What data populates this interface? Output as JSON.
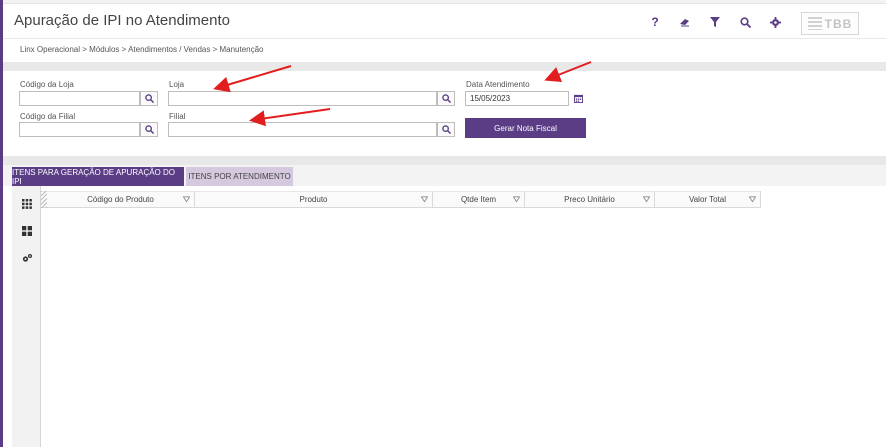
{
  "header": {
    "title": "Apuração de IPI no Atendimento",
    "icons": [
      "help-icon",
      "eraser-icon",
      "filter-icon",
      "search-icon",
      "gear-icon"
    ],
    "help_glyph": "?",
    "logo_text": "TBB"
  },
  "breadcrumb": "Linx Operacional  >  Módulos  >  Atendimentos / Vendas  >  Manutenção",
  "form": {
    "codigo_loja_label": "Código da Loja",
    "codigo_loja_value": "",
    "loja_label": "Loja",
    "loja_value": "",
    "data_atendimento_label": "Data Atendimento",
    "data_atendimento_value": "15/05/2023",
    "codigo_filial_label": "Código da Filial",
    "codigo_filial_value": "",
    "filial_label": "Filial",
    "filial_value": "",
    "gerar_button": "Gerar Nota Fiscal"
  },
  "tabs": [
    {
      "label": "ITENS PARA GERAÇÃO DE APURAÇÃO DO IPI",
      "active": true
    },
    {
      "label": "ITENS POR ATENDIMENTO",
      "active": false
    }
  ],
  "grid": {
    "columns": [
      "Código do Produto",
      "Produto",
      "Qtde Item",
      "Preco Unitário",
      "Valor Total"
    ],
    "rows": []
  },
  "colors": {
    "accent": "#5a3d85",
    "tab_inactive": "#d4c9de",
    "annotation_arrow": "#e21d1d"
  }
}
